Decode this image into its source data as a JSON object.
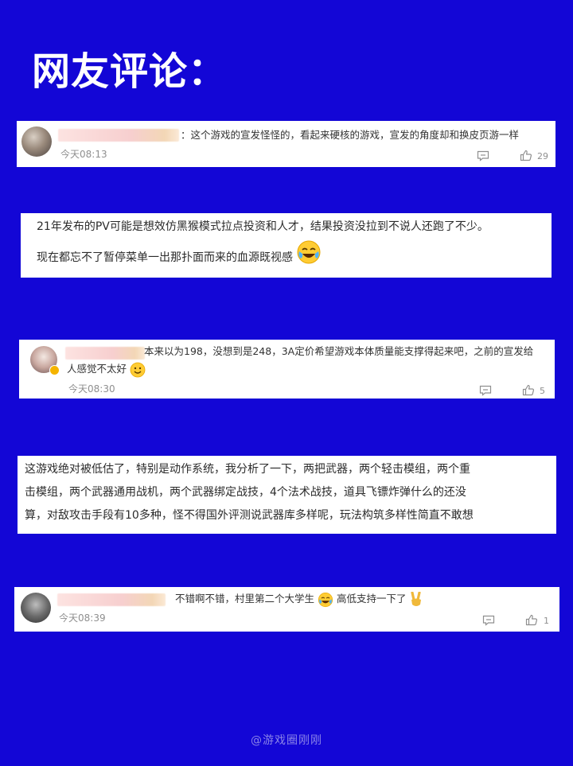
{
  "page": {
    "title": "网友评论：",
    "watermark": "@游戏圈刚刚"
  },
  "comments": [
    {
      "text": "：这个游戏的宣发怪怪的，看起来硬核的游戏，宣发的角度却和换皮页游一样",
      "time": "今天08:13",
      "likes": "29"
    },
    {
      "lines": [
        "21年发布的PV可能是想效仿黑猴模式拉点投资和人才，结果投资没拉到不说人还跑了不少。",
        "现在都忘不了暂停菜单一出那扑面而来的血源既视感"
      ]
    },
    {
      "lines": [
        "本来以为198，没想到是248，3A定价希望游戏本体质量能支撑得起来吧，之前的宣发给",
        "人感觉不太好"
      ],
      "time": "今天08:30",
      "likes": "5"
    },
    {
      "lines": [
        "这游戏绝对被低估了，特别是动作系统，我分析了一下，两把武器，两个轻击模组，两个重",
        "击模组，两个武器通用战机，两个武器绑定战技，4个法术战技，道具飞镖炸弹什么的还没",
        "算，对敌攻击手段有10多种，怪不得国外评测说武器库多样呢，玩法构筑多样性简直不敢想"
      ]
    },
    {
      "text_a": "不错啊不错，村里第二个大学生",
      "text_b": "高低支持一下了",
      "time": "今天08:39",
      "likes": "1"
    }
  ],
  "icons": {
    "reply": "reply-icon",
    "like": "thumbs-up-icon",
    "tears_joy": "tears-of-joy-emoji",
    "grin": "grinning-emoji",
    "victory": "victory-hand-emoji"
  }
}
